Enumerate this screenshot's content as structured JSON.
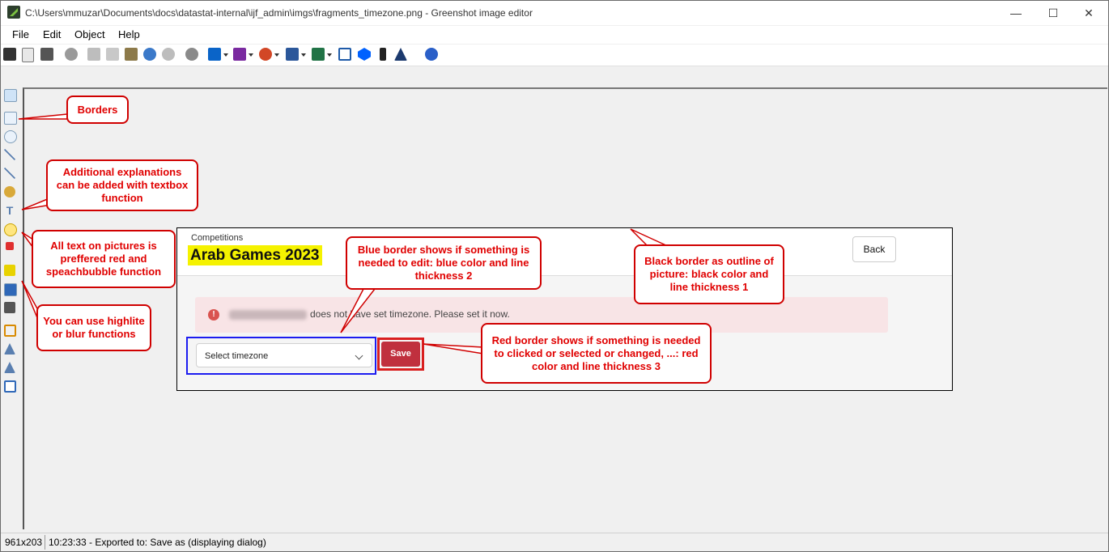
{
  "window": {
    "title": "C:\\Users\\mmuzar\\Documents\\docs\\datastat-internal\\ijf_admin\\imgs\\fragments_timezone.png - Greenshot image editor",
    "minimize": "—",
    "maximize": "☐",
    "close": "✕"
  },
  "menu": [
    "File",
    "Edit",
    "Object",
    "Help"
  ],
  "toolbar_icons": [
    "save-icon",
    "clipboard-icon",
    "print-icon",
    "delete-icon",
    "cut-icon",
    "copy-icon",
    "paste-icon",
    "undo-icon",
    "redo-icon",
    "settings-icon",
    "outlook-icon",
    "onenote-icon",
    "powerpoint-icon",
    "word-icon",
    "excel-icon",
    "window-icon",
    "dropbox-icon",
    "imgur-icon",
    "help-icon"
  ],
  "left_tools": [
    "select-icon",
    "rectangle-icon",
    "ellipse-icon",
    "line-icon",
    "arrow-icon",
    "freehand-icon",
    "text-icon",
    "speechbubble-icon",
    "counter-icon",
    "highlight-icon",
    "obfuscate-icon",
    "effects-icon",
    "crop-icon",
    "rotate-left-icon",
    "rotate-right-icon",
    "resize-icon"
  ],
  "picture": {
    "breadcrumb": "Competitions",
    "title": "Arab Games 2023",
    "back_label": "Back",
    "alert_text": "does not have set timezone. Please set it now.",
    "select_placeholder": "Select timezone",
    "save_label": "Save"
  },
  "callouts": {
    "borders": "Borders",
    "explanations": "Additional explanations can be added with textbox function",
    "text_red": "All text on pictures is preffered red and speachbubble function",
    "highlight": "You can use highlite or blur functions",
    "blue_border": "Blue border shows if something is needed to edit: blue color and line thickness 2",
    "black_border": "Black border as outline of picture: black color and line thickness 1",
    "red_border": "Red border shows if something is needed to clicked or selected or changed, ...: red color and line thickness 3"
  },
  "status": {
    "size": "961x203",
    "message": "10:23:33 - Exported to: Save as (displaying dialog)"
  },
  "colors": {
    "callout_red": "#e00000",
    "blue_border": "#1c1cf0",
    "black_border": "#000000",
    "save_button": "#c0303e",
    "title_highlight": "#f5f200"
  }
}
